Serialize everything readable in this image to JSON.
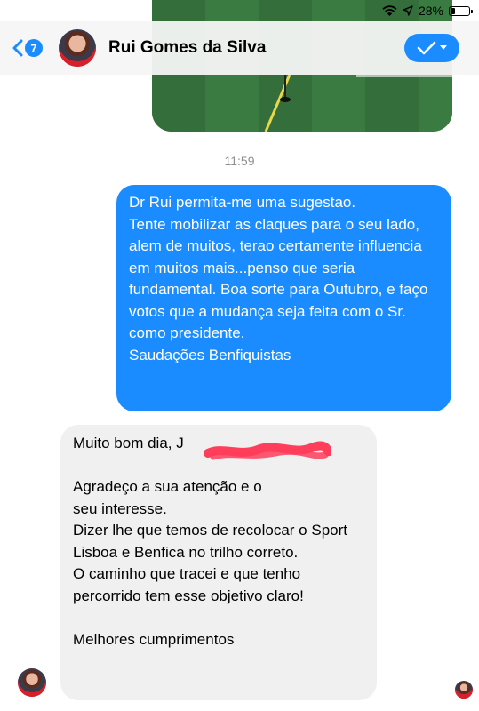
{
  "status_bar": {
    "battery_percent_label": "28%",
    "battery_level": 0.28
  },
  "header": {
    "back_count": "7",
    "contact_name": "Rui Gomes da Silva"
  },
  "conversation": {
    "timestamp": "11:59",
    "outgoing_message": "Dr Rui permita-me uma sugestao.\nTente mobilizar as claques para o seu lado, alem de muitos, terao certamente influencia em muitos mais...penso que seria  fundamental. Boa sorte para Outubro, e faço votos que a mudança seja feita com o Sr. como presidente.\nSaudações Benfiquistas",
    "incoming_message": "Muito bom dia, J\n\nAgradeço a sua atenção e o\nseu interesse.\nDizer lhe que temos de recolocar o Sport Lisboa e Benfica no trilho correto.\nO caminho que tracei e que tenho percorrido tem esse objetivo claro!\n\nMelhores cumprimentos"
  },
  "colors": {
    "accent": "#1a8cff",
    "incoming_bubble": "#f0f0f0",
    "outgoing_bubble": "#1a8cff"
  },
  "icons": {
    "back": "chevron-left-icon",
    "wifi": "wifi-icon",
    "location": "location-arrow-icon",
    "battery": "battery-icon",
    "confirm": "checkmark-icon",
    "dropdown": "chevron-down-icon"
  }
}
